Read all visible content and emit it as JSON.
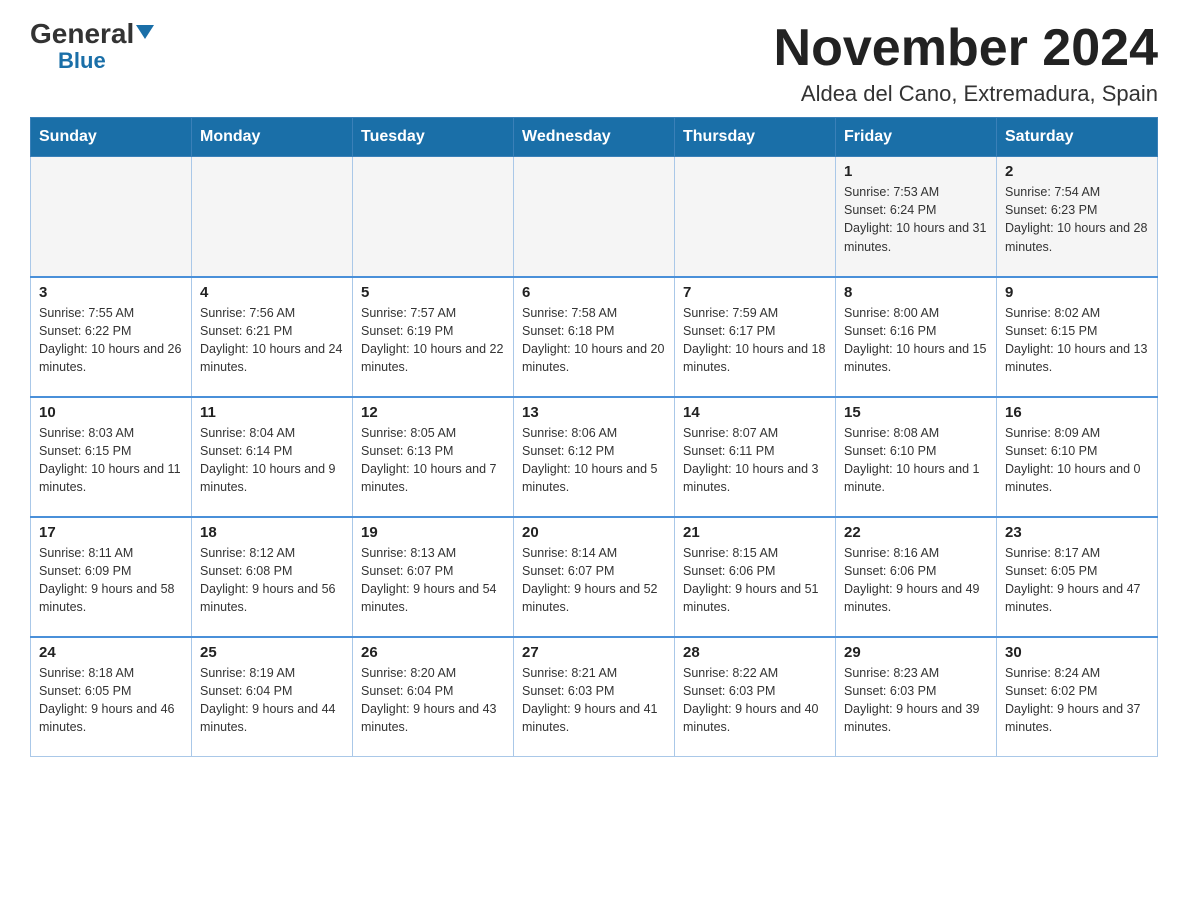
{
  "header": {
    "logo_general": "General",
    "logo_blue": "Blue",
    "main_title": "November 2024",
    "subtitle": "Aldea del Cano, Extremadura, Spain"
  },
  "days_of_week": [
    "Sunday",
    "Monday",
    "Tuesday",
    "Wednesday",
    "Thursday",
    "Friday",
    "Saturday"
  ],
  "weeks": [
    {
      "days": [
        {
          "number": "",
          "info": ""
        },
        {
          "number": "",
          "info": ""
        },
        {
          "number": "",
          "info": ""
        },
        {
          "number": "",
          "info": ""
        },
        {
          "number": "",
          "info": ""
        },
        {
          "number": "1",
          "info": "Sunrise: 7:53 AM\nSunset: 6:24 PM\nDaylight: 10 hours and 31 minutes."
        },
        {
          "number": "2",
          "info": "Sunrise: 7:54 AM\nSunset: 6:23 PM\nDaylight: 10 hours and 28 minutes."
        }
      ]
    },
    {
      "days": [
        {
          "number": "3",
          "info": "Sunrise: 7:55 AM\nSunset: 6:22 PM\nDaylight: 10 hours and 26 minutes."
        },
        {
          "number": "4",
          "info": "Sunrise: 7:56 AM\nSunset: 6:21 PM\nDaylight: 10 hours and 24 minutes."
        },
        {
          "number": "5",
          "info": "Sunrise: 7:57 AM\nSunset: 6:19 PM\nDaylight: 10 hours and 22 minutes."
        },
        {
          "number": "6",
          "info": "Sunrise: 7:58 AM\nSunset: 6:18 PM\nDaylight: 10 hours and 20 minutes."
        },
        {
          "number": "7",
          "info": "Sunrise: 7:59 AM\nSunset: 6:17 PM\nDaylight: 10 hours and 18 minutes."
        },
        {
          "number": "8",
          "info": "Sunrise: 8:00 AM\nSunset: 6:16 PM\nDaylight: 10 hours and 15 minutes."
        },
        {
          "number": "9",
          "info": "Sunrise: 8:02 AM\nSunset: 6:15 PM\nDaylight: 10 hours and 13 minutes."
        }
      ]
    },
    {
      "days": [
        {
          "number": "10",
          "info": "Sunrise: 8:03 AM\nSunset: 6:15 PM\nDaylight: 10 hours and 11 minutes."
        },
        {
          "number": "11",
          "info": "Sunrise: 8:04 AM\nSunset: 6:14 PM\nDaylight: 10 hours and 9 minutes."
        },
        {
          "number": "12",
          "info": "Sunrise: 8:05 AM\nSunset: 6:13 PM\nDaylight: 10 hours and 7 minutes."
        },
        {
          "number": "13",
          "info": "Sunrise: 8:06 AM\nSunset: 6:12 PM\nDaylight: 10 hours and 5 minutes."
        },
        {
          "number": "14",
          "info": "Sunrise: 8:07 AM\nSunset: 6:11 PM\nDaylight: 10 hours and 3 minutes."
        },
        {
          "number": "15",
          "info": "Sunrise: 8:08 AM\nSunset: 6:10 PM\nDaylight: 10 hours and 1 minute."
        },
        {
          "number": "16",
          "info": "Sunrise: 8:09 AM\nSunset: 6:10 PM\nDaylight: 10 hours and 0 minutes."
        }
      ]
    },
    {
      "days": [
        {
          "number": "17",
          "info": "Sunrise: 8:11 AM\nSunset: 6:09 PM\nDaylight: 9 hours and 58 minutes."
        },
        {
          "number": "18",
          "info": "Sunrise: 8:12 AM\nSunset: 6:08 PM\nDaylight: 9 hours and 56 minutes."
        },
        {
          "number": "19",
          "info": "Sunrise: 8:13 AM\nSunset: 6:07 PM\nDaylight: 9 hours and 54 minutes."
        },
        {
          "number": "20",
          "info": "Sunrise: 8:14 AM\nSunset: 6:07 PM\nDaylight: 9 hours and 52 minutes."
        },
        {
          "number": "21",
          "info": "Sunrise: 8:15 AM\nSunset: 6:06 PM\nDaylight: 9 hours and 51 minutes."
        },
        {
          "number": "22",
          "info": "Sunrise: 8:16 AM\nSunset: 6:06 PM\nDaylight: 9 hours and 49 minutes."
        },
        {
          "number": "23",
          "info": "Sunrise: 8:17 AM\nSunset: 6:05 PM\nDaylight: 9 hours and 47 minutes."
        }
      ]
    },
    {
      "days": [
        {
          "number": "24",
          "info": "Sunrise: 8:18 AM\nSunset: 6:05 PM\nDaylight: 9 hours and 46 minutes."
        },
        {
          "number": "25",
          "info": "Sunrise: 8:19 AM\nSunset: 6:04 PM\nDaylight: 9 hours and 44 minutes."
        },
        {
          "number": "26",
          "info": "Sunrise: 8:20 AM\nSunset: 6:04 PM\nDaylight: 9 hours and 43 minutes."
        },
        {
          "number": "27",
          "info": "Sunrise: 8:21 AM\nSunset: 6:03 PM\nDaylight: 9 hours and 41 minutes."
        },
        {
          "number": "28",
          "info": "Sunrise: 8:22 AM\nSunset: 6:03 PM\nDaylight: 9 hours and 40 minutes."
        },
        {
          "number": "29",
          "info": "Sunrise: 8:23 AM\nSunset: 6:03 PM\nDaylight: 9 hours and 39 minutes."
        },
        {
          "number": "30",
          "info": "Sunrise: 8:24 AM\nSunset: 6:02 PM\nDaylight: 9 hours and 37 minutes."
        }
      ]
    }
  ]
}
